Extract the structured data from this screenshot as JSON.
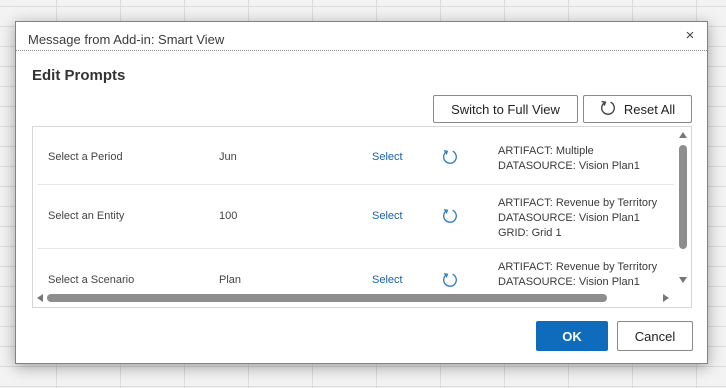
{
  "dialog": {
    "title": "Message from Add-in: Smart View",
    "close_glyph": "×",
    "heading": "Edit Prompts"
  },
  "toolbar": {
    "switch_label": "Switch to Full View",
    "reset_label": "Reset All",
    "reset_icon": "refresh-icon"
  },
  "rows": [
    {
      "label": "Select a Period",
      "value": "Jun",
      "link": "Select",
      "info": [
        "ARTIFACT: Multiple",
        "DATASOURCE: Vision Plan1"
      ]
    },
    {
      "label": "Select an Entity",
      "value": "100",
      "link": "Select",
      "info": [
        "ARTIFACT: Revenue by Territory",
        "DATASOURCE: Vision Plan1",
        "GRID: Grid 1"
      ]
    },
    {
      "label": "Select a Scenario",
      "value": "Plan",
      "link": "Select",
      "info": [
        "ARTIFACT: Revenue by Territory",
        "DATASOURCE: Vision Plan1"
      ]
    }
  ],
  "footer": {
    "ok_label": "OK",
    "cancel_label": "Cancel"
  },
  "colors": {
    "accent": "#0f6cbd",
    "link": "#1a5fa8",
    "refresh_icon": "#2a7bbf"
  }
}
